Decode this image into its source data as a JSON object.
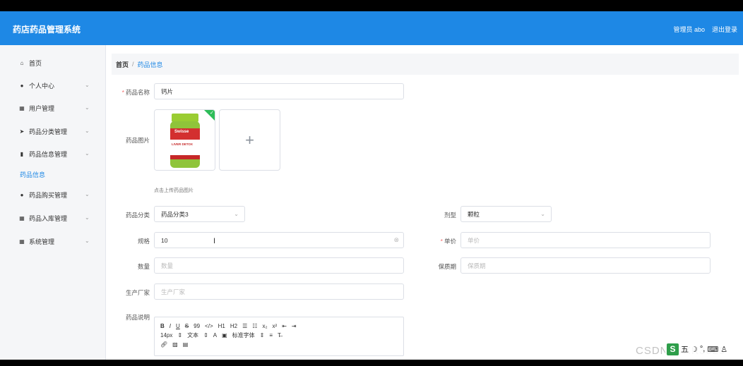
{
  "app": {
    "title": "药店药品管理系统",
    "user": "管理员 abo",
    "logout": "退出登录"
  },
  "sidebar": {
    "items": [
      {
        "label": "首页",
        "icon": "home-icon"
      },
      {
        "label": "个人中心",
        "icon": "user-icon"
      },
      {
        "label": "用户管理",
        "icon": "grid-icon"
      },
      {
        "label": "药品分类管理",
        "icon": "send-icon"
      },
      {
        "label": "药品信息管理",
        "icon": "file-icon"
      },
      {
        "label": "药品信息",
        "icon": ""
      },
      {
        "label": "药品购买管理",
        "icon": "user-icon"
      },
      {
        "label": "药品入库管理",
        "icon": "grid-icon"
      },
      {
        "label": "系统管理",
        "icon": "grid-icon"
      }
    ]
  },
  "breadcrumb": {
    "home": "首页",
    "separator": "/",
    "current": "药品信息"
  },
  "form": {
    "name": {
      "label": "药品名称",
      "value": "钙片"
    },
    "image": {
      "label": "药品图片",
      "tip": "点击上传药品图片",
      "product_brand": "Swisse",
      "product_name": "LIVER DETOX"
    },
    "category": {
      "label": "药品分类",
      "value": "药品分类3"
    },
    "dosage": {
      "label": "剂型",
      "value": "颗粒"
    },
    "spec": {
      "label": "规格",
      "value": "10"
    },
    "price": {
      "label": "单价",
      "placeholder": "单价"
    },
    "quantity": {
      "label": "数量",
      "placeholder": "数量"
    },
    "shelf_life": {
      "label": "保质期",
      "placeholder": "保质期"
    },
    "manufacturer": {
      "label": "生产厂家",
      "placeholder": "生产厂家"
    },
    "description": {
      "label": "药品说明"
    }
  },
  "editor": {
    "row1": [
      "B",
      "I",
      "U",
      "S",
      "99",
      "</>",
      "H1",
      "H2",
      "☰",
      "☷",
      "x₂",
      "x²",
      "⇤",
      "⇥"
    ],
    "font_size": "14px",
    "text_type": "文本",
    "font_family": "标准字体"
  },
  "watermark": "CSDN @XK3029",
  "ime": {
    "label": "五"
  }
}
